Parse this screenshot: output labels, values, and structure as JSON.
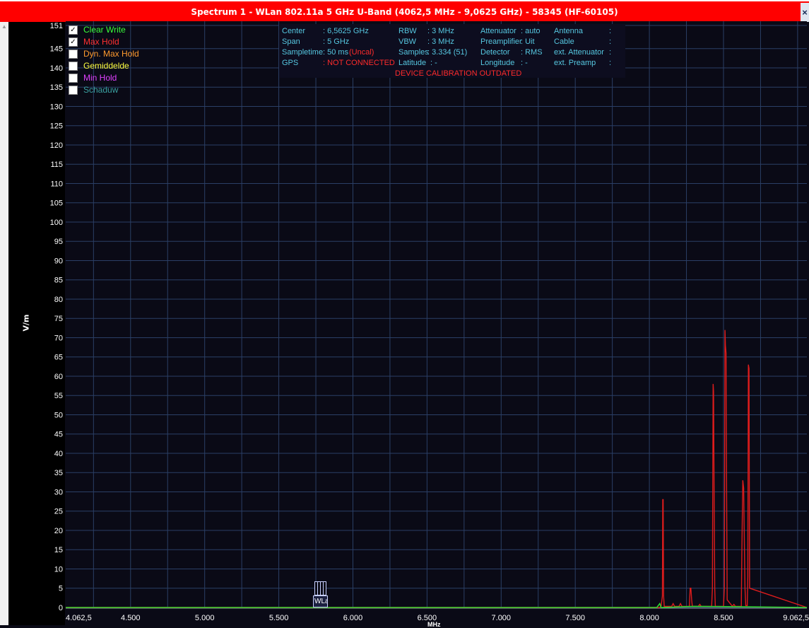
{
  "window": {
    "title": "Spectrum 1 - WLan 802.11a 5 GHz U-Band (4062,5 MHz - 9,0625 GHz) - 58345 (HF-60105)",
    "close_label": "×"
  },
  "legend": [
    {
      "label": "Clear Write",
      "checked": true,
      "color": "#39ff39"
    },
    {
      "label": "Max Hold",
      "checked": true,
      "color": "#ff3030"
    },
    {
      "label": "Dyn. Max Hold",
      "checked": false,
      "color": "#ff9a2e"
    },
    {
      "label": "Gemiddelde",
      "checked": false,
      "color": "#ffff40"
    },
    {
      "label": "Min Hold",
      "checked": false,
      "color": "#e040ff"
    },
    {
      "label": "Schaduw",
      "checked": false,
      "color": "#3aa0a0"
    }
  ],
  "info": {
    "center_label": "Center",
    "center_value": ": 6,5625 GHz",
    "span_label": "Span",
    "span_value": ": 5 GHz",
    "sampletime_label": "Sampletime",
    "sampletime_value": ": 50 ms",
    "sampletime_flag": "(Uncal)",
    "gps_label": "GPS",
    "gps_value": ": NOT CONNECTED",
    "rbw_label": "RBW",
    "rbw_value": ": 3 MHz",
    "vbw_label": "VBW",
    "vbw_value": ": 3 MHz",
    "samples_label": "Samples",
    "samples_value": ": 3.334 (51)",
    "latitude_label": "Latitude",
    "latitude_value": ": -",
    "attenuator_label": "Attenuator",
    "attenuator_value": ": auto",
    "preamp_label": "Preamplifier",
    "preamp_value": ": Uit",
    "detector_label": "Detector",
    "detector_value": ": RMS",
    "longitude_label": "Longitude",
    "longitude_value": ": -",
    "antenna_label": "Antenna",
    "antenna_value": ":",
    "cable_label": "Cable",
    "cable_value": ":",
    "ext_att_label": "ext. Attenuator",
    "ext_att_value": ":",
    "ext_preamp_label": "ext. Preamp",
    "ext_preamp_value": ":",
    "calibration_warning": "DEVICE CALIBRATION OUTDATED"
  },
  "marker": {
    "label": "WLa"
  },
  "colors": {
    "background": "#0a0a16",
    "grid": "#2b3f66",
    "title_bar": "#ff0000",
    "info_text": "#56c7e0",
    "warning_text": "#ff2b2b",
    "max_hold": "#dd1c1c",
    "clear_write": "#2fd62f"
  },
  "chart_data": {
    "type": "line",
    "ylabel": "V/m",
    "xlabel": "MHz",
    "xlim": [
      4062.5,
      9062.5
    ],
    "ylim": [
      0,
      151
    ],
    "x_tick_labels": [
      "4.062,5",
      "4.500",
      "5.000",
      "5.500",
      "6.000",
      "6.500",
      "7.000",
      "7.500",
      "8.000",
      "8.500",
      "9.062,5"
    ],
    "x_tick_values": [
      4062.5,
      4500,
      5000,
      5500,
      6000,
      6500,
      7000,
      7500,
      8000,
      8500,
      9062.5
    ],
    "y_tick_labels": [
      "0",
      "5",
      "10",
      "15",
      "20",
      "25",
      "30",
      "35",
      "40",
      "45",
      "50",
      "55",
      "60",
      "65",
      "70",
      "75",
      "80",
      "85",
      "90",
      "95",
      "100",
      "105",
      "110",
      "115",
      "120",
      "125",
      "130",
      "135",
      "140",
      "145",
      "151"
    ],
    "y_tick_values": [
      0,
      5,
      10,
      15,
      20,
      25,
      30,
      35,
      40,
      45,
      50,
      55,
      60,
      65,
      70,
      75,
      80,
      85,
      90,
      95,
      100,
      105,
      110,
      115,
      120,
      125,
      130,
      135,
      140,
      145,
      151
    ],
    "grid": true,
    "series": [
      {
        "name": "Max Hold",
        "x": [
          4062.5,
          8070,
          8080,
          8088,
          8090,
          8093,
          8096,
          8100,
          8150,
          8160,
          8170,
          8200,
          8210,
          8220,
          8270,
          8275,
          8280,
          8285,
          8290,
          8330,
          8340,
          8350,
          8420,
          8425,
          8430,
          8433,
          8437,
          8441,
          8445,
          8500,
          8506,
          8510,
          8513,
          8517,
          8521,
          8525,
          8560,
          8570,
          8580,
          8620,
          8624,
          8630,
          8636,
          8640,
          8645,
          8650,
          8660,
          8664,
          8668,
          8672,
          8676,
          9062.5
        ],
        "y": [
          0,
          0,
          0.5,
          3,
          28,
          28,
          3,
          0.3,
          0.3,
          1,
          0.3,
          0.3,
          1,
          0.3,
          0.3,
          5,
          5,
          2,
          0.3,
          0.3,
          0.8,
          0.3,
          0.3,
          5,
          58,
          56,
          27,
          5,
          0.3,
          0.3,
          5,
          72,
          68,
          66,
          30,
          2,
          0.3,
          0.8,
          0.3,
          0.3,
          15,
          33,
          31,
          18,
          5,
          0.5,
          0.5,
          8,
          63,
          62,
          5,
          0
        ]
      },
      {
        "name": "Clear Write",
        "x": [
          4062.5,
          8050,
          8060,
          8070,
          8080,
          8300,
          8600,
          9062.5
        ],
        "y": [
          0,
          0,
          0.5,
          1,
          0,
          0.3,
          0.2,
          0
        ]
      }
    ]
  }
}
